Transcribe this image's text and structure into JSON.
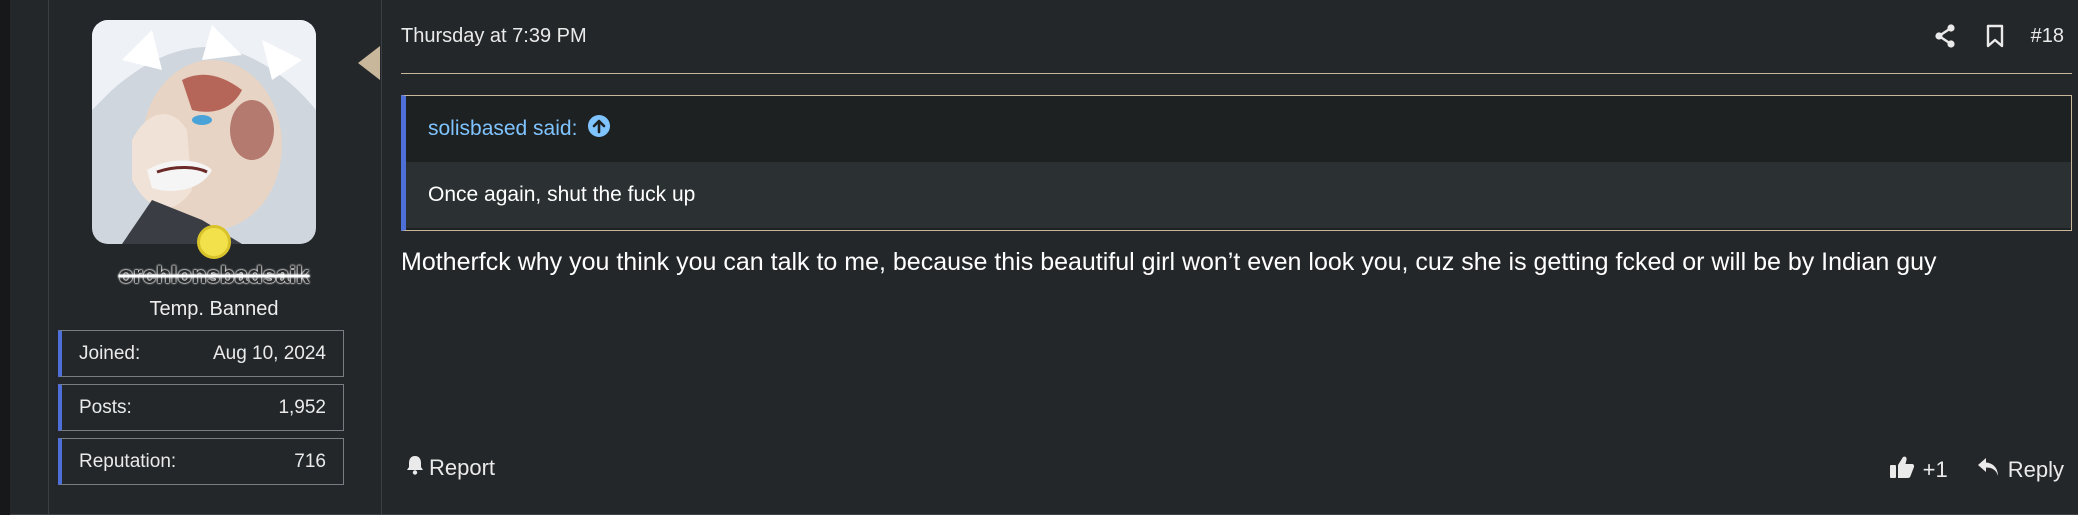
{
  "user": {
    "username": "orchlonsbadsaik",
    "title": "Temp. Banned",
    "avatar_icon": "avatar-image",
    "stats": [
      {
        "label": "Joined:",
        "value": "Aug 10, 2024"
      },
      {
        "label": "Posts:",
        "value": "1,952"
      },
      {
        "label": "Reputation:",
        "value": "716"
      }
    ]
  },
  "post": {
    "date": "Thursday at 7:39 PM",
    "number": "#18",
    "share_icon": "share-icon",
    "bookmark_icon": "bookmark-icon",
    "quote": {
      "author": "solisbased said:",
      "goto_icon": "arrow-up-circle-icon",
      "text": "Once again, shut the fuck up"
    },
    "message": "Motherfck why you think you can talk to me, because this beautiful girl won’t even look you, cuz she is getting fcked or will be by Indian guy",
    "actions": {
      "report": "Report",
      "like": "+1",
      "reply": "Reply"
    }
  },
  "colors": {
    "accent_blue": "#4f6fd8",
    "link_blue": "#7fc4ff",
    "divider_tan": "#c8b79a",
    "status_yellow": "#f2e14a"
  }
}
